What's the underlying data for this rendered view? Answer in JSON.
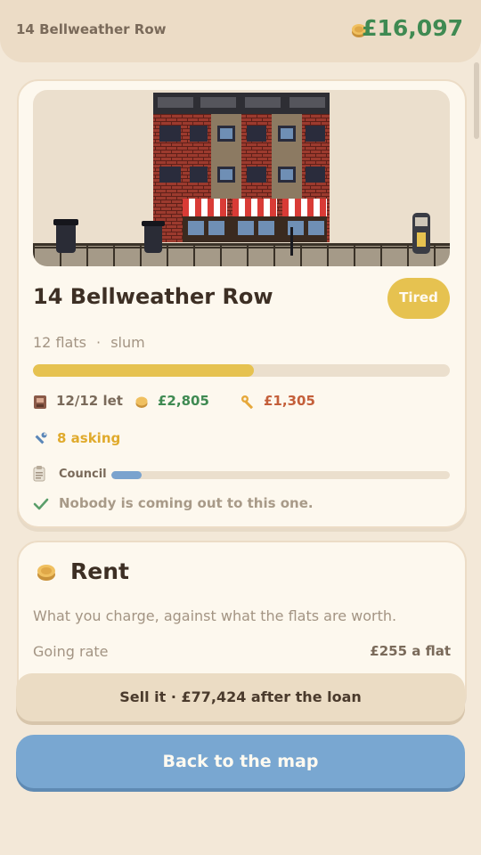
{
  "header": {
    "address": "14 Bellweather Row",
    "balance": "£16,097",
    "coin_icon": "coin-icon"
  },
  "property": {
    "name": "14 Bellweather Row",
    "status_badge": "Tired",
    "flats": "12 flats",
    "separator": "·",
    "grade": "slum",
    "condition_fraction": 0.53,
    "occupancy": "12/12 let",
    "income": "£2,805",
    "costs": "£1,305",
    "repairs": "8 asking",
    "council_label": "Council",
    "council_fraction": 0.09,
    "note": "Nobody is coming out to this one."
  },
  "rent": {
    "title": "Rent",
    "description": "What you charge, against what the flats are worth.",
    "going_rate_label": "Going rate",
    "going_rate_value": "£255 a flat"
  },
  "actions": {
    "sell_label": "Sell it  ·  £77,424 after the loan",
    "back_label": "Back to the map"
  },
  "colors": {
    "background": "#f3e8d8",
    "accent_green": "#3f8a52",
    "badge_yellow": "#e6c250",
    "cost_red": "#c45f3a",
    "council_blue": "#7aa3ce",
    "button_blue": "#79a7d1"
  }
}
